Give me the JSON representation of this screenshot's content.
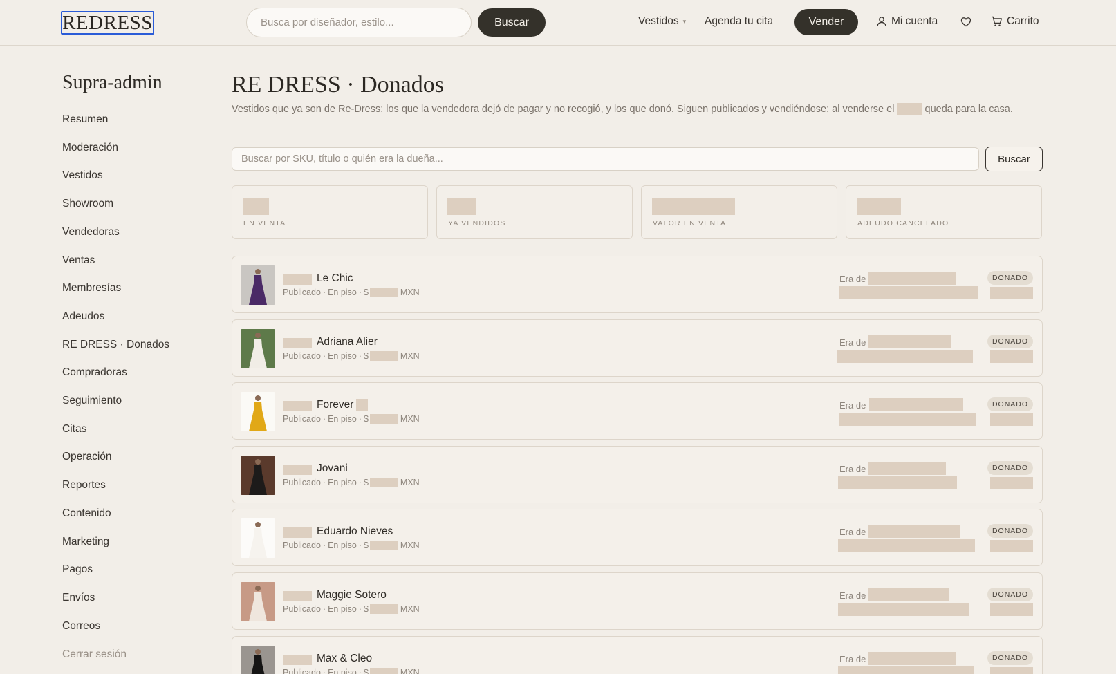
{
  "header": {
    "logo_text": "REDRESS",
    "search_placeholder": "Busca por diseñador, estilo...",
    "search_button": "Buscar",
    "nav": {
      "vestidos": "Vestidos",
      "agenda": "Agenda tu cita",
      "vender": "Vender",
      "cuenta": "Mi cuenta",
      "carrito": "Carrito"
    },
    "icons": {
      "account": "user-icon",
      "favorites": "heart-icon",
      "cart": "cart-icon",
      "dropdown": "chevron-down-icon"
    }
  },
  "sidebar": {
    "title": "Supra-admin",
    "items": [
      "Resumen",
      "Moderación",
      "Vestidos",
      "Showroom",
      "Vendedoras",
      "Ventas",
      "Membresías",
      "Adeudos",
      "RE DRESS · Donados",
      "Compradoras",
      "Seguimiento",
      "Citas",
      "Operación",
      "Reportes",
      "Contenido",
      "Marketing",
      "Pagos",
      "Envíos",
      "Correos"
    ],
    "logout": "Cerrar sesión"
  },
  "main": {
    "title": "RE DRESS · Donados",
    "description_part1": "Vestidos que ya son de Re-Dress: los que la vendedora dejó de pagar y no recogió, y los que donó. Siguen publicados y vendiéndose; al venderse el",
    "description_part2": "queda para la casa.",
    "search_placeholder": "Buscar por SKU, título o quién era la dueña...",
    "search_button": "Buscar",
    "stats": [
      {
        "label": "EN VENTA"
      },
      {
        "label": "YA VENDIDOS"
      },
      {
        "label": "VALOR EN VENTA"
      },
      {
        "label": "ADEUDO CANCELADO"
      }
    ],
    "rows": [
      {
        "brand": "Le Chic",
        "status": "Publicado",
        "location": "En piso",
        "currency_prefix": "$",
        "currency": "MXN",
        "owner_label": "Era de",
        "badge": "DONADO",
        "thumb_color": "#4a2a66",
        "thumb_bg": "#c9c6c2"
      },
      {
        "brand": "Adriana Alier",
        "status": "Publicado",
        "location": "En piso",
        "currency_prefix": "$",
        "currency": "MXN",
        "owner_label": "Era de",
        "badge": "DONADO",
        "thumb_color": "#f1ede6",
        "thumb_bg": "#5e7a4a"
      },
      {
        "brand": "Forever",
        "status": "Publicado",
        "location": "En piso",
        "currency_prefix": "$",
        "currency": "MXN",
        "owner_label": "Era de",
        "badge": "DONADO",
        "thumb_color": "#e1a817",
        "thumb_bg": "#fbfaf6"
      },
      {
        "brand": "Jovani",
        "status": "Publicado",
        "location": "En piso",
        "currency_prefix": "$",
        "currency": "MXN",
        "owner_label": "Era de",
        "badge": "DONADO",
        "thumb_color": "#1d1b1a",
        "thumb_bg": "#5a3a2c"
      },
      {
        "brand": "Eduardo Nieves",
        "status": "Publicado",
        "location": "En piso",
        "currency_prefix": "$",
        "currency": "MXN",
        "owner_label": "Era de",
        "badge": "DONADO",
        "thumb_color": "#f6f3ee",
        "thumb_bg": "#fcfbf9"
      },
      {
        "brand": "Maggie Sotero",
        "status": "Publicado",
        "location": "En piso",
        "currency_prefix": "$",
        "currency": "MXN",
        "owner_label": "Era de",
        "badge": "DONADO",
        "thumb_color": "#efe6dd",
        "thumb_bg": "#c79a86"
      },
      {
        "brand": "Max & Cleo",
        "status": "Publicado",
        "location": "En piso",
        "currency_prefix": "$",
        "currency": "MXN",
        "owner_label": "Era de",
        "badge": "DONADO",
        "thumb_color": "#151414",
        "thumb_bg": "#9a9590"
      }
    ],
    "separator": "·"
  }
}
